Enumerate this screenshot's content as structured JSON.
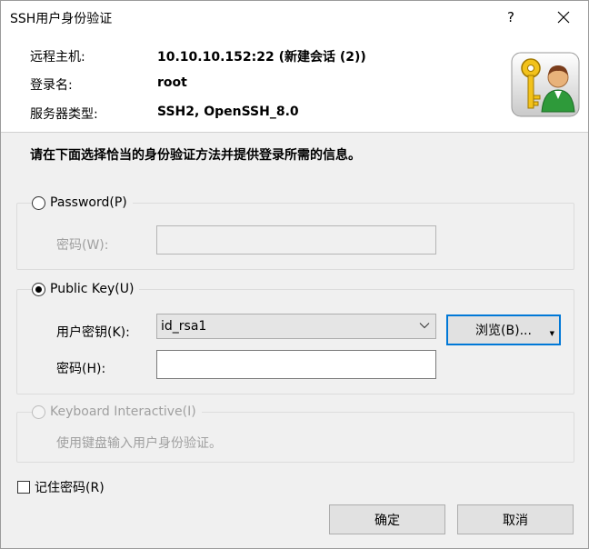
{
  "window": {
    "title": "SSH用户身份验证",
    "help_label": "?"
  },
  "info": {
    "host_label": "远程主机:",
    "host_value": "10.10.10.152:22 (新建会话 (2))",
    "login_label": "登录名:",
    "login_value": "root",
    "server_type_label": "服务器类型:",
    "server_type_value": "SSH2, OpenSSH_8.0"
  },
  "instruction": "请在下面选择恰当的身份验证方法并提供登录所需的信息。",
  "password_group": {
    "label": "Password(P)",
    "checked": false,
    "password_label": "密码(W):",
    "password_value": ""
  },
  "publickey_group": {
    "label": "Public Key(U)",
    "checked": true,
    "key_label": "用户密钥(K):",
    "key_value": "id_rsa1",
    "browse_label": "浏览(B)...",
    "passphrase_label": "密码(H):",
    "passphrase_value": ""
  },
  "keyboard_group": {
    "label": "Keyboard Interactive(I)",
    "checked": false,
    "description": "使用键盘输入用户身份验证。"
  },
  "remember": {
    "label": "记住密码(R)",
    "checked": false
  },
  "buttons": {
    "ok_label": "确定",
    "cancel_label": "取消"
  },
  "icons": {
    "close": "close-icon",
    "user_key": "user-key-icon",
    "dropdown": "chevron-down-icon"
  }
}
